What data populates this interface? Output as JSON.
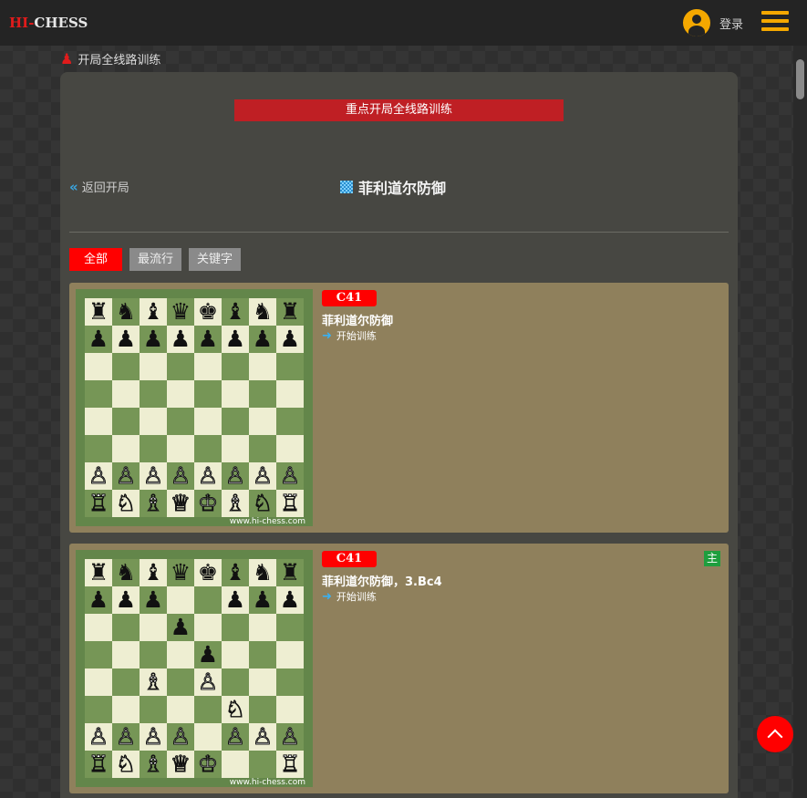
{
  "header": {
    "logo_prefix": "HI-",
    "logo_suffix": "CHESS",
    "login_label": "登录",
    "menu_icon": "hamburger-menu-icon",
    "accent_color": "#f5a800"
  },
  "breadcrumb": {
    "label": "开局全线路训练",
    "icon": "chess-piece-icon"
  },
  "banner": {
    "label": "重点开局全线路训练",
    "color": "#bf1f24"
  },
  "page": {
    "back_label": "返回开局",
    "title": "菲利道尔防御"
  },
  "filters": [
    {
      "label": "全部",
      "active": true
    },
    {
      "label": "最流行",
      "active": false
    },
    {
      "label": "关键字",
      "active": false
    }
  ],
  "cards": [
    {
      "eco": "C41",
      "name": "菲利道尔防御",
      "start_label": "开始训练",
      "watermark": "www.hi-chess.com",
      "main_badge": "",
      "board": [
        "rnbqkbnr",
        "pppppppp",
        "........",
        "........",
        "........",
        "........",
        "PPPPPPPP",
        "RNBQKBNR"
      ]
    },
    {
      "eco": "C41",
      "name": "菲利道尔防御，3.Bc4",
      "start_label": "开始训练",
      "watermark": "www.hi-chess.com",
      "main_badge": "主",
      "board": [
        "rnbqkbnr",
        "ppp..ppp",
        "...p....",
        "....p...",
        "..B.P...",
        ".....N..",
        "PPPP.PPP",
        "RNBQK..R"
      ]
    }
  ],
  "colors": {
    "primary_red": "#ff0000",
    "card_bg": "#8f805c",
    "panel_bg": "#474742"
  }
}
